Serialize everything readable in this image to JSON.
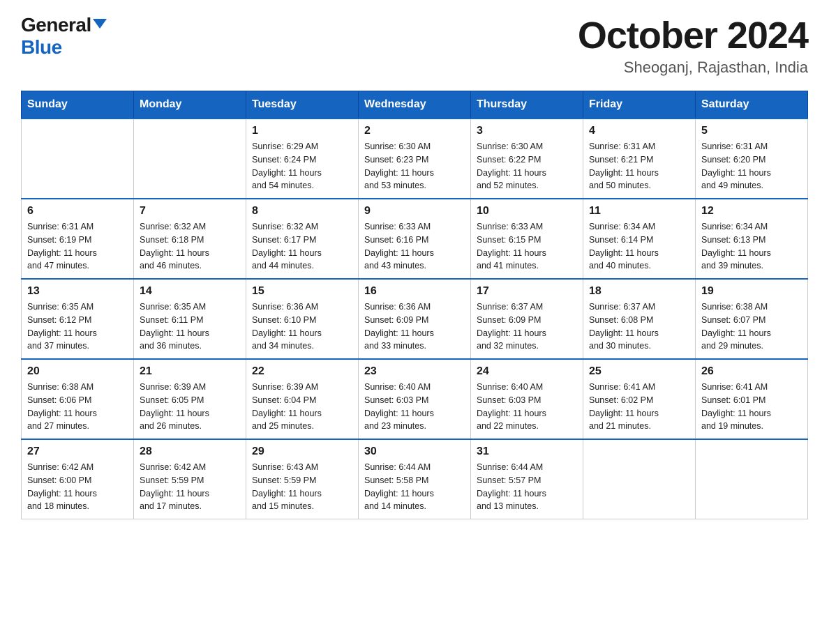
{
  "header": {
    "logo_general": "General",
    "logo_blue": "Blue",
    "title": "October 2024",
    "location": "Sheoganj, Rajasthan, India"
  },
  "days_of_week": [
    "Sunday",
    "Monday",
    "Tuesday",
    "Wednesday",
    "Thursday",
    "Friday",
    "Saturday"
  ],
  "weeks": [
    [
      {
        "day": "",
        "info": ""
      },
      {
        "day": "",
        "info": ""
      },
      {
        "day": "1",
        "info": "Sunrise: 6:29 AM\nSunset: 6:24 PM\nDaylight: 11 hours\nand 54 minutes."
      },
      {
        "day": "2",
        "info": "Sunrise: 6:30 AM\nSunset: 6:23 PM\nDaylight: 11 hours\nand 53 minutes."
      },
      {
        "day": "3",
        "info": "Sunrise: 6:30 AM\nSunset: 6:22 PM\nDaylight: 11 hours\nand 52 minutes."
      },
      {
        "day": "4",
        "info": "Sunrise: 6:31 AM\nSunset: 6:21 PM\nDaylight: 11 hours\nand 50 minutes."
      },
      {
        "day": "5",
        "info": "Sunrise: 6:31 AM\nSunset: 6:20 PM\nDaylight: 11 hours\nand 49 minutes."
      }
    ],
    [
      {
        "day": "6",
        "info": "Sunrise: 6:31 AM\nSunset: 6:19 PM\nDaylight: 11 hours\nand 47 minutes."
      },
      {
        "day": "7",
        "info": "Sunrise: 6:32 AM\nSunset: 6:18 PM\nDaylight: 11 hours\nand 46 minutes."
      },
      {
        "day": "8",
        "info": "Sunrise: 6:32 AM\nSunset: 6:17 PM\nDaylight: 11 hours\nand 44 minutes."
      },
      {
        "day": "9",
        "info": "Sunrise: 6:33 AM\nSunset: 6:16 PM\nDaylight: 11 hours\nand 43 minutes."
      },
      {
        "day": "10",
        "info": "Sunrise: 6:33 AM\nSunset: 6:15 PM\nDaylight: 11 hours\nand 41 minutes."
      },
      {
        "day": "11",
        "info": "Sunrise: 6:34 AM\nSunset: 6:14 PM\nDaylight: 11 hours\nand 40 minutes."
      },
      {
        "day": "12",
        "info": "Sunrise: 6:34 AM\nSunset: 6:13 PM\nDaylight: 11 hours\nand 39 minutes."
      }
    ],
    [
      {
        "day": "13",
        "info": "Sunrise: 6:35 AM\nSunset: 6:12 PM\nDaylight: 11 hours\nand 37 minutes."
      },
      {
        "day": "14",
        "info": "Sunrise: 6:35 AM\nSunset: 6:11 PM\nDaylight: 11 hours\nand 36 minutes."
      },
      {
        "day": "15",
        "info": "Sunrise: 6:36 AM\nSunset: 6:10 PM\nDaylight: 11 hours\nand 34 minutes."
      },
      {
        "day": "16",
        "info": "Sunrise: 6:36 AM\nSunset: 6:09 PM\nDaylight: 11 hours\nand 33 minutes."
      },
      {
        "day": "17",
        "info": "Sunrise: 6:37 AM\nSunset: 6:09 PM\nDaylight: 11 hours\nand 32 minutes."
      },
      {
        "day": "18",
        "info": "Sunrise: 6:37 AM\nSunset: 6:08 PM\nDaylight: 11 hours\nand 30 minutes."
      },
      {
        "day": "19",
        "info": "Sunrise: 6:38 AM\nSunset: 6:07 PM\nDaylight: 11 hours\nand 29 minutes."
      }
    ],
    [
      {
        "day": "20",
        "info": "Sunrise: 6:38 AM\nSunset: 6:06 PM\nDaylight: 11 hours\nand 27 minutes."
      },
      {
        "day": "21",
        "info": "Sunrise: 6:39 AM\nSunset: 6:05 PM\nDaylight: 11 hours\nand 26 minutes."
      },
      {
        "day": "22",
        "info": "Sunrise: 6:39 AM\nSunset: 6:04 PM\nDaylight: 11 hours\nand 25 minutes."
      },
      {
        "day": "23",
        "info": "Sunrise: 6:40 AM\nSunset: 6:03 PM\nDaylight: 11 hours\nand 23 minutes."
      },
      {
        "day": "24",
        "info": "Sunrise: 6:40 AM\nSunset: 6:03 PM\nDaylight: 11 hours\nand 22 minutes."
      },
      {
        "day": "25",
        "info": "Sunrise: 6:41 AM\nSunset: 6:02 PM\nDaylight: 11 hours\nand 21 minutes."
      },
      {
        "day": "26",
        "info": "Sunrise: 6:41 AM\nSunset: 6:01 PM\nDaylight: 11 hours\nand 19 minutes."
      }
    ],
    [
      {
        "day": "27",
        "info": "Sunrise: 6:42 AM\nSunset: 6:00 PM\nDaylight: 11 hours\nand 18 minutes."
      },
      {
        "day": "28",
        "info": "Sunrise: 6:42 AM\nSunset: 5:59 PM\nDaylight: 11 hours\nand 17 minutes."
      },
      {
        "day": "29",
        "info": "Sunrise: 6:43 AM\nSunset: 5:59 PM\nDaylight: 11 hours\nand 15 minutes."
      },
      {
        "day": "30",
        "info": "Sunrise: 6:44 AM\nSunset: 5:58 PM\nDaylight: 11 hours\nand 14 minutes."
      },
      {
        "day": "31",
        "info": "Sunrise: 6:44 AM\nSunset: 5:57 PM\nDaylight: 11 hours\nand 13 minutes."
      },
      {
        "day": "",
        "info": ""
      },
      {
        "day": "",
        "info": ""
      }
    ]
  ]
}
